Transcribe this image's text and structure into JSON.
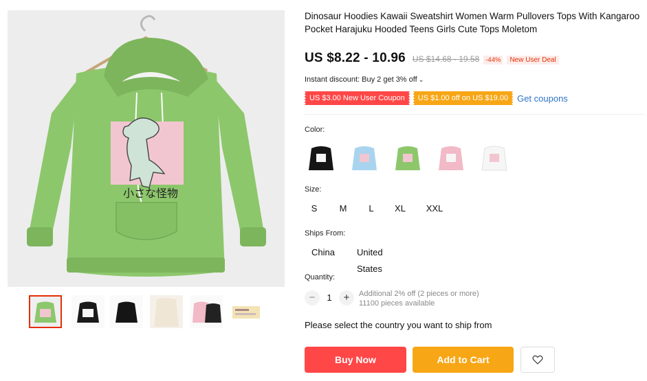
{
  "product": {
    "title": "Dinosaur Hoodies Kawaii Sweatshirt Women Warm Pullovers Tops With Kangaroo Pocket Harajuku Hooded Teens Girls Cute Tops Moletom",
    "image_caption": "小さな怪物"
  },
  "price": {
    "current": "US $8.22 - 10.96",
    "original": "US $14.68 - 19.58",
    "discount": "-44%",
    "deal": "New User Deal"
  },
  "promo": {
    "instant_discount": "Instant discount: Buy 2 get 3% off",
    "coupon_new_user": "US $3.00 New User Coupon",
    "coupon_store": "US $1.00 off on US $19.00",
    "get_coupons": "Get coupons"
  },
  "color": {
    "label": "Color:",
    "options": [
      {
        "name": "black",
        "hex": "#151515"
      },
      {
        "name": "blue",
        "hex": "#a9d4ef"
      },
      {
        "name": "green",
        "hex": "#8dc76c"
      },
      {
        "name": "pink",
        "hex": "#f2b9c7"
      },
      {
        "name": "white",
        "hex": "#f6f6f6"
      }
    ]
  },
  "size": {
    "label": "Size:",
    "options": [
      "S",
      "M",
      "L",
      "XL",
      "XXL"
    ]
  },
  "ships": {
    "label": "Ships From:",
    "options": [
      "China",
      "United States"
    ]
  },
  "quantity": {
    "label": "Quantity:",
    "value": "1",
    "minus": "−",
    "plus": "+",
    "info_line1": "Additional 2% off (2 pieces or more)",
    "info_line2": "11100 pieces available"
  },
  "ship_message": "Please select the country you want to ship from",
  "actions": {
    "buy_now": "Buy Now",
    "add_to_cart": "Add to Cart"
  },
  "colors": {
    "accent_red": "#ff4747",
    "accent_orange": "#f7a616",
    "link_blue": "#2e74c9",
    "hoodie_green": "#8dc76c"
  },
  "icons": [
    "chevron-down-icon",
    "heart-icon"
  ]
}
